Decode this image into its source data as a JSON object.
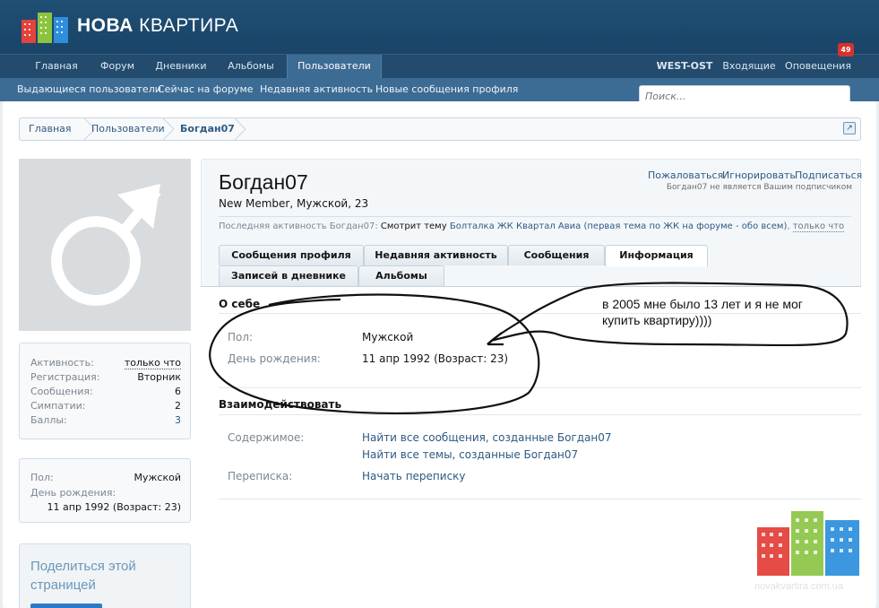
{
  "brand": {
    "bold": "НОВА",
    "rest": "КВАРТИРА"
  },
  "nav": {
    "tabs": [
      "Главная",
      "Форум",
      "Дневники",
      "Альбомы",
      "Пользователи"
    ],
    "user": "WEST-OST",
    "inbox": "Входящие",
    "alerts": "Оповещения",
    "alerts_count": "49"
  },
  "subnav": [
    "Выдающиеся пользователи",
    "Сейчас на форуме",
    "Недавняя активность",
    "Новые сообщения профиля"
  ],
  "search": {
    "placeholder": "Поиск..."
  },
  "breadcrumb": [
    "Главная",
    "Пользователи",
    "Богдан07"
  ],
  "sidebar": {
    "stats": [
      {
        "label": "Активность:",
        "value": "только что"
      },
      {
        "label": "Регистрация:",
        "value": "Вторник"
      },
      {
        "label": "Сообщения:",
        "value": "6"
      },
      {
        "label": "Симпатии:",
        "value": "2"
      },
      {
        "label": "Баллы:",
        "value": "3"
      }
    ],
    "info": {
      "gender_label": "Пол:",
      "gender": "Мужской",
      "birthday_label": "День рождения:",
      "birthday": "11 апр 1992 (Возраст: 23)"
    },
    "share_title": "Поделиться этой страницей"
  },
  "profile": {
    "username": "Богдан07",
    "usertitle": "New Member, Мужской, 23",
    "actions": [
      "Пожаловаться",
      "Игнорировать",
      "Подписаться"
    ],
    "follow_note": "Богдан07 не является Вашим подписчиком",
    "activity": {
      "prefix": "Последняя активность Богдан07:",
      "verb": "Смотрит тему",
      "topic": "Болталка ЖК Квартал Авиа (первая тема по ЖК на форуме - обо всем)",
      "comma": ",",
      "time": "только что"
    },
    "tabs_row1": [
      "Сообщения профиля",
      "Недавняя активность",
      "Сообщения",
      "Информация"
    ],
    "tabs_row2": [
      "Записей в дневнике",
      "Альбомы"
    ]
  },
  "about": {
    "title": "О себе",
    "gender_label": "Пол:",
    "gender": "Мужской",
    "birthday_label": "День рождения:",
    "birthday": "11 апр 1992 (Возраст: 23)"
  },
  "interact": {
    "title": "Взаимодействовать",
    "content_label": "Содержимое:",
    "find_posts": "Найти все сообщения, созданные Богдан07",
    "find_threads": "Найти все темы, созданные Богдан07",
    "convo_label": "Переписка:",
    "start_convo": "Начать переписку"
  },
  "annotation_note": "в 2005 мне было 13 лет и я не мог купить квартиру))))",
  "watermark": "novakvartira.com.ua",
  "colors": {
    "header": "#1f4e74",
    "nav": "#234b6e",
    "subnav": "#3c6b94",
    "link": "#2e5a82"
  },
  "icons": {
    "avatar": "male-symbol-icon",
    "jump": "external-link-icon"
  }
}
